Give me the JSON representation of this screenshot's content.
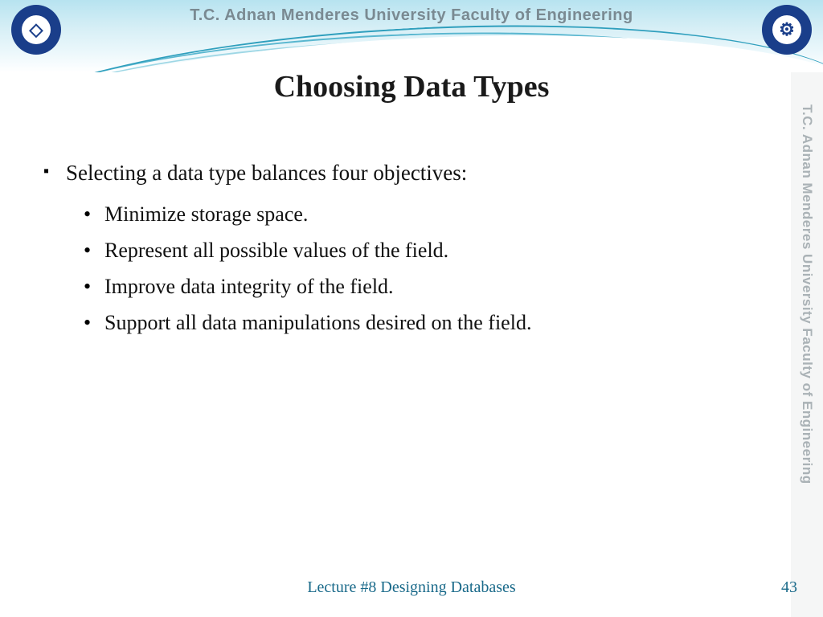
{
  "header": {
    "org_text": "T.C.   Adnan Menderes University   Faculty of Engineering"
  },
  "slide": {
    "title": "Choosing Data Types",
    "bullet": "Selecting a data type balances four objectives:",
    "subitems": [
      "Minimize storage space.",
      "Represent all possible values of the field.",
      "Improve data integrity of the field.",
      "Support all data manipulations desired on the field."
    ]
  },
  "footer": {
    "lecture": "Lecture #8 Designing Databases",
    "page": "43"
  },
  "side": {
    "text": "T.C.   Adnan Menderes University   Faculty of Engineering"
  }
}
